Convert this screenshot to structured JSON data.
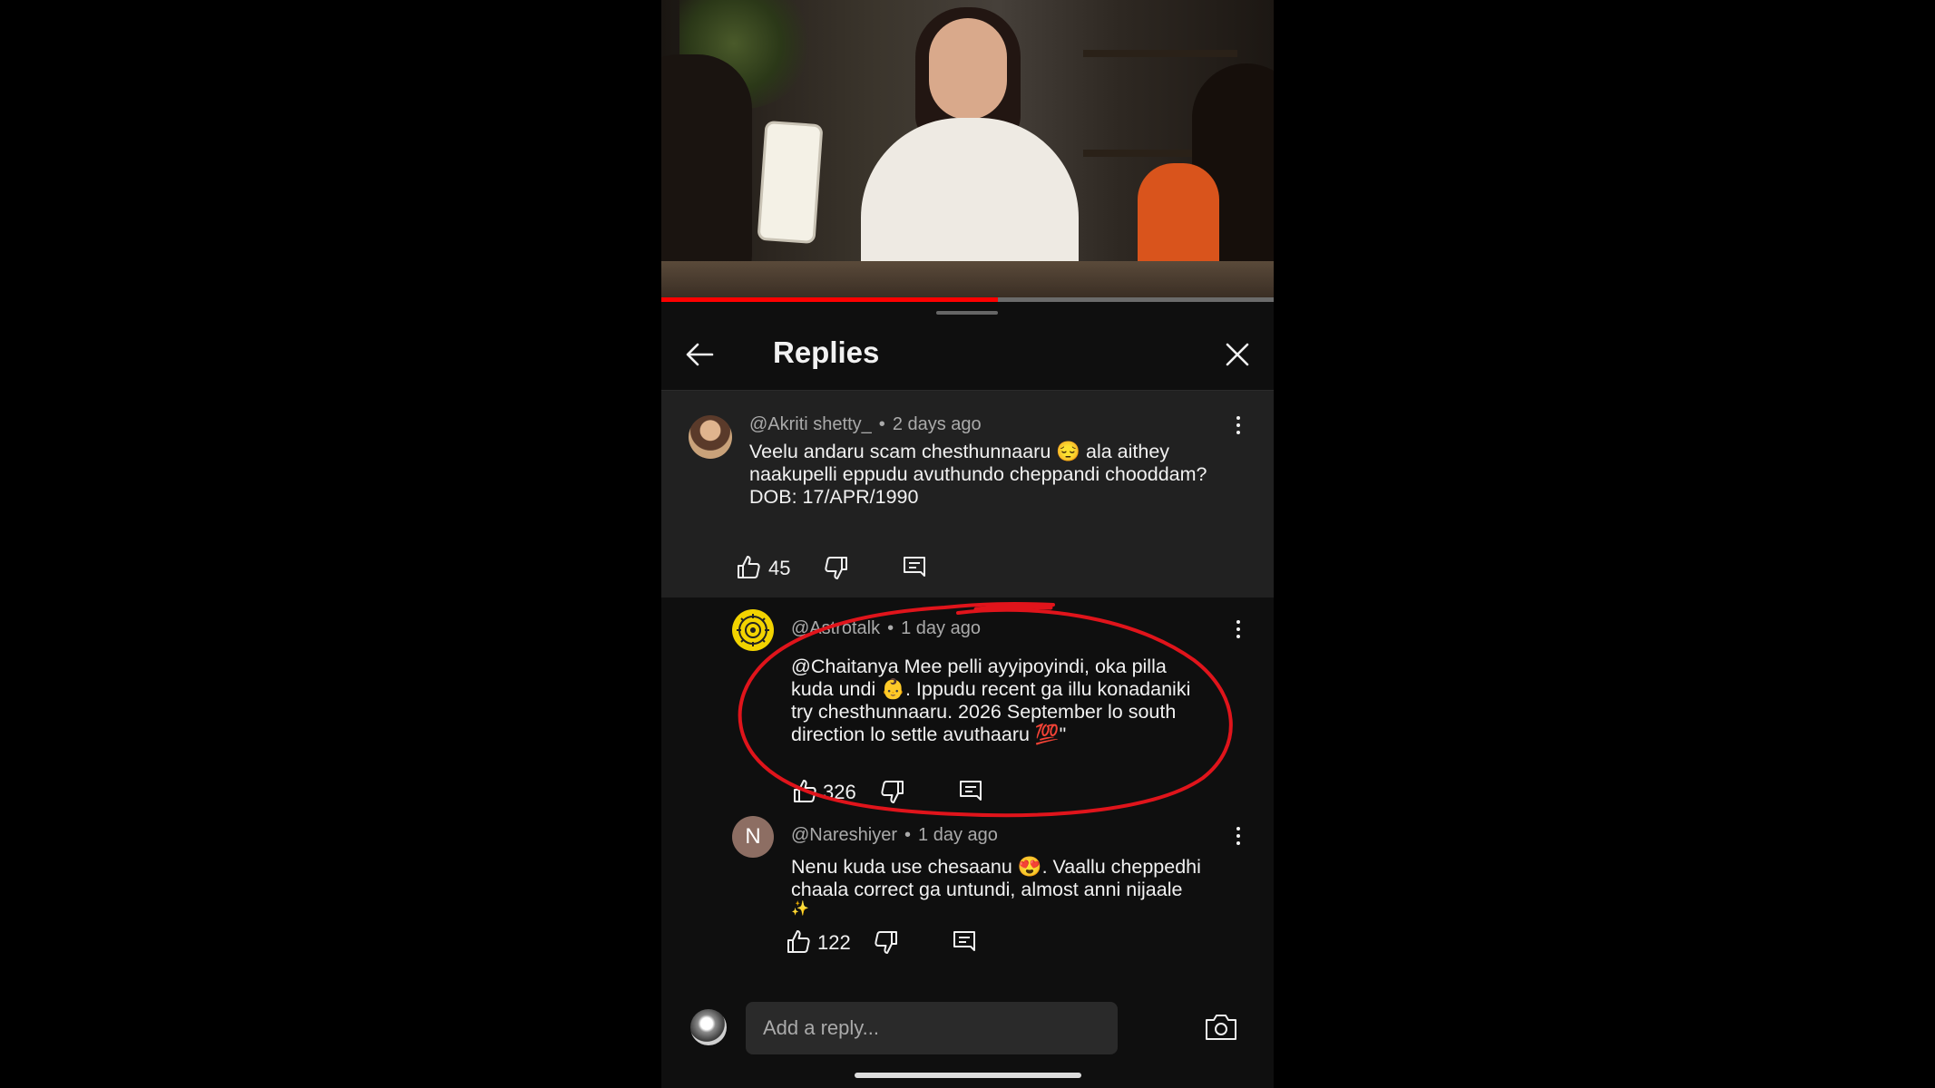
{
  "video": {
    "progress_fraction": 0.55
  },
  "header": {
    "title": "Replies"
  },
  "parent_comment": {
    "handle": "@Akriti shetty_",
    "separator": "•",
    "time": "2 days ago",
    "text_line1": "Veelu andaru scam chesthunnaaru 😔 ala aithey",
    "text_line2": "naakupelli eppudu avuthundo cheppandi chooddam?",
    "text_line3": "DOB: 17/APR/1990",
    "likes": "45"
  },
  "replies": [
    {
      "handle": "@Astrotalk",
      "separator": "•",
      "time": "1 day ago",
      "text_line1": "@Chaitanya Mee pelli ayyipoyindi, oka pilla",
      "text_line2": "kuda undi 👶. Ippudu recent ga illu konadaniki",
      "text_line3": "try chesthunnaaru. 2026 September lo south",
      "text_line4": "direction lo settle avuthaaru 💯\"",
      "likes": "326"
    },
    {
      "handle": "@Nareshiyer",
      "separator": "•",
      "time": "1 day ago",
      "avatar_letter": "N",
      "text_line1": "Nenu kuda use chesaanu 😍. Vaallu cheppedhi",
      "text_line2": "chaala correct ga untundi, almost anni nijaale",
      "text_line3": "✨",
      "likes": "122"
    }
  ],
  "composer": {
    "placeholder": "Add a reply..."
  },
  "colors": {
    "background": "#0f0f0f",
    "parent_bg": "#212121",
    "annotation_red": "#e0141b",
    "progress_red": "#ff0000",
    "nareshiyer_avatar": "#8d6e63"
  }
}
